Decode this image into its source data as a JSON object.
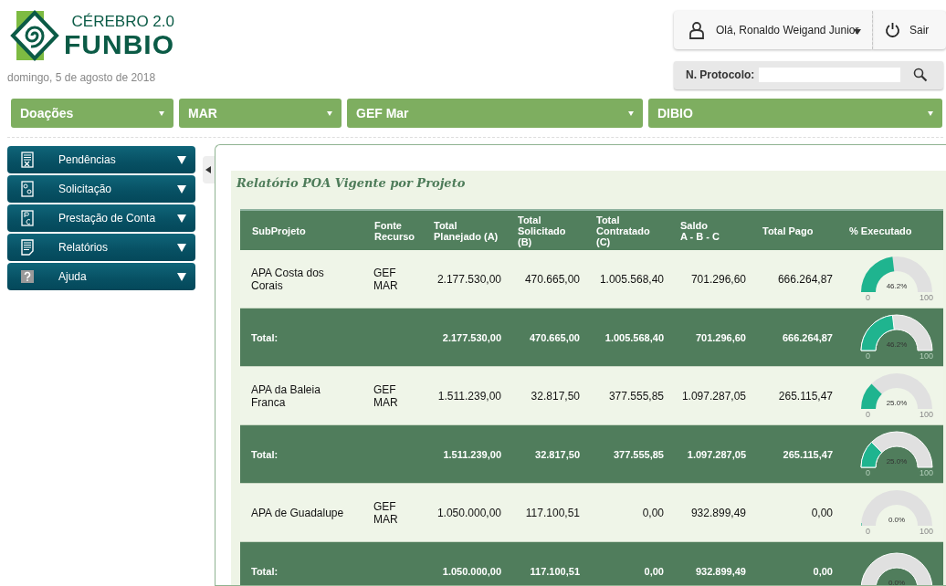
{
  "header": {
    "logo": {
      "subtitle": "CÉREBRO 2.0",
      "name": "FUNBIO"
    },
    "date": "domingo, 5 de agosto de 2018",
    "user": {
      "greeting": "Olá, Ronaldo Weigand Junior"
    },
    "logout": {
      "label": "Sair"
    },
    "protocol": {
      "label": "N. Protocolo:"
    }
  },
  "filters": [
    {
      "value": "Doações"
    },
    {
      "value": "MAR"
    },
    {
      "value": "GEF Mar"
    },
    {
      "value": "DIBIO"
    }
  ],
  "sidebar": {
    "items": [
      {
        "label": "Pendências",
        "kind": "pending"
      },
      {
        "label": "Solicitação",
        "kind": "request"
      },
      {
        "label": "Prestação de Conta",
        "kind": "account"
      },
      {
        "label": "Relatórios",
        "kind": "report"
      },
      {
        "label": "Ajuda",
        "kind": "help"
      }
    ]
  },
  "report": {
    "title": "Relatório POA Vigente por Projeto",
    "columns": [
      "SubProjeto",
      "Fonte\nRecurso",
      "Total\nPlanejado (A)",
      "Total\nSolicitado\n(B)",
      "Total\nContratado\n(C)",
      "Saldo\nA - B - C",
      "Total Pago",
      "% Executado"
    ],
    "rows": [
      {
        "kind": "item",
        "cells": [
          "APA Costa dos\nCorais",
          "GEF\nMAR",
          "2.177.530,00",
          "470.665,00",
          "1.005.568,40",
          "701.296,60",
          "666.264,87"
        ],
        "executed": {
          "level": 0.462,
          "reading": "46.2%",
          "min": "0",
          "max": "100"
        }
      },
      {
        "kind": "total",
        "cells": [
          "Total:",
          "",
          "2.177.530,00",
          "470.665,00",
          "1.005.568,40",
          "701.296,60",
          "666.264,87"
        ],
        "executed": {
          "level": 0.462,
          "reading": "46.2%",
          "min": "0",
          "max": "100"
        }
      },
      {
        "kind": "item",
        "cells": [
          "APA da Baleia\nFranca",
          "GEF\nMAR",
          "1.511.239,00",
          "32.817,50",
          "377.555,85",
          "1.097.287,05",
          "265.115,47"
        ],
        "executed": {
          "level": 0.25,
          "reading": "25.0%",
          "min": "0",
          "max": "100"
        }
      },
      {
        "kind": "total",
        "cells": [
          "Total:",
          "",
          "1.511.239,00",
          "32.817,50",
          "377.555,85",
          "1.097.287,05",
          "265.115,47"
        ],
        "executed": {
          "level": 0.25,
          "reading": "25.0%",
          "min": "0",
          "max": "100"
        }
      },
      {
        "kind": "item",
        "cells": [
          "APA de Guadalupe",
          "GEF\nMAR",
          "1.050.000,00",
          "117.100,51",
          "0,00",
          "932.899,49",
          "0,00"
        ],
        "executed": {
          "level": 0,
          "reading": "0.0%",
          "min": "0",
          "max": "100"
        }
      },
      {
        "kind": "total",
        "cells": [
          "Total:",
          "",
          "1.050.000,00",
          "117.100,51",
          "0,00",
          "932.899,49",
          "0,00"
        ],
        "executed": {
          "reading": "0.0%"
        }
      }
    ]
  }
}
